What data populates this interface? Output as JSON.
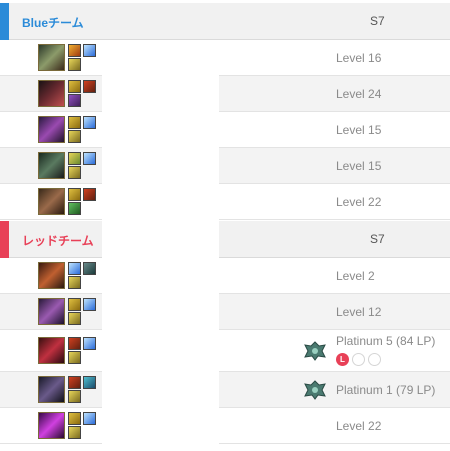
{
  "colors": {
    "blue_accent": "#2b8bd8",
    "red_accent": "#e84057"
  },
  "blue_team": {
    "name": "Blueチーム",
    "season": "S7",
    "players": [
      {
        "rank": "Level 16",
        "champion_icon": "champion-portrait",
        "spell_icons": [
          "ignite",
          "flash"
        ]
      },
      {
        "rank": "Level 24",
        "champion_icon": "champion-portrait",
        "spell_icons": [
          "exhaust",
          "ignite"
        ]
      },
      {
        "rank": "Level 15",
        "champion_icon": "champion-portrait",
        "spell_icons": [
          "exhaust",
          "flash"
        ]
      },
      {
        "rank": "Level 15",
        "champion_icon": "champion-portrait",
        "spell_icons": [
          "heal",
          "flash"
        ]
      },
      {
        "rank": "Level 22",
        "champion_icon": "champion-portrait",
        "spell_icons": [
          "exhaust",
          "ignite"
        ]
      }
    ]
  },
  "red_team": {
    "name": "レッドチーム",
    "season": "S7",
    "players": [
      {
        "rank": "Level 2",
        "champion_icon": "champion-portrait",
        "spell_icons": [
          "flash",
          "smite"
        ]
      },
      {
        "rank": "Level 12",
        "champion_icon": "champion-portrait",
        "spell_icons": [
          "exhaust",
          "flash"
        ]
      },
      {
        "rank": "Platinum 5 (84 LP)",
        "tier_icon": "platinum-emblem",
        "promo_loss_mark": "L",
        "promo_series": [
          "loss",
          "empty",
          "empty"
        ],
        "champion_icon": "champion-portrait",
        "spell_icons": [
          "ignite",
          "flash"
        ]
      },
      {
        "rank": "Platinum 1 (79 LP)",
        "tier_icon": "platinum-emblem",
        "champion_icon": "champion-portrait",
        "spell_icons": [
          "ignite",
          "teleport"
        ]
      },
      {
        "rank": "Level 22",
        "champion_icon": "champion-portrait",
        "spell_icons": [
          "exhaust",
          "flash"
        ]
      }
    ]
  }
}
